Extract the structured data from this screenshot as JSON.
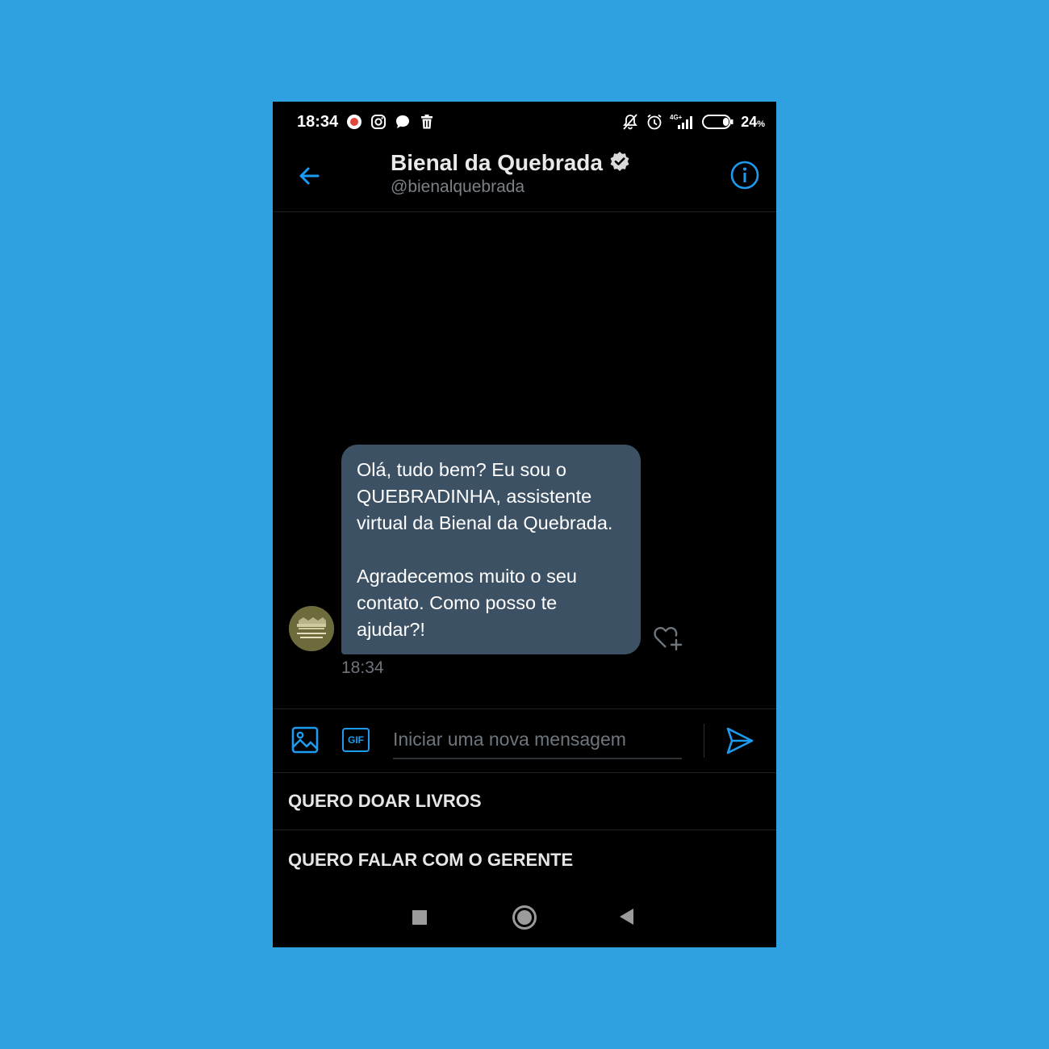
{
  "status_bar": {
    "time": "18:34",
    "battery": "24",
    "battery_unit": "%",
    "network": "4G+",
    "icons": [
      "notification-app-icon",
      "instagram-icon",
      "chat-bubble-icon",
      "trash-icon",
      "muted-bell-icon",
      "alarm-icon",
      "signal-icon",
      "battery-icon"
    ]
  },
  "header": {
    "title": "Bienal da Quebrada",
    "handle": "@bienalquebrada",
    "verified": true
  },
  "conversation": {
    "message_text": "Olá, tudo bem? Eu sou o QUEBRADINHA, assistente virtual da Bienal da Quebrada.\n\nAgradecemos muito o seu contato. Como posso te ajudar?!",
    "message_time": "18:34"
  },
  "composer": {
    "gif_label": "GIF",
    "placeholder": "Iniciar uma nova mensagem",
    "value": ""
  },
  "quick_replies": [
    "QUERO DOAR LIVROS",
    "QUERO FALAR COM O GERENTE"
  ],
  "colors": {
    "background": "#2fa0e0",
    "accent": "#1d9bf0",
    "bubble": "#3c5164",
    "screen": "#000000"
  }
}
